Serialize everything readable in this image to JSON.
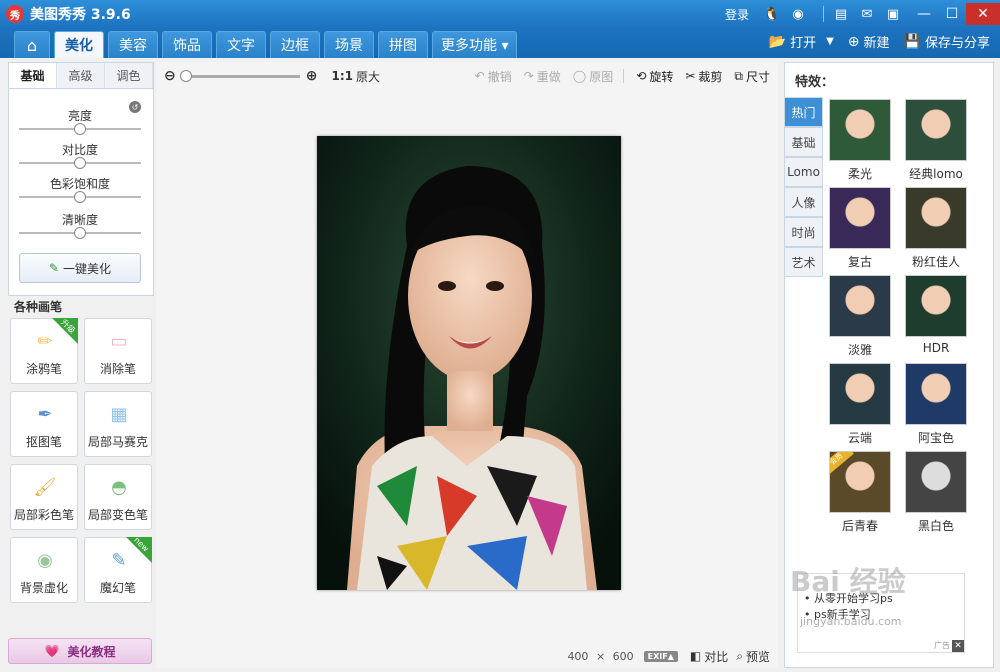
{
  "app": {
    "logo_text": "秀",
    "title": "美图秀秀 3.9.6",
    "login": "登录"
  },
  "tabs": [
    {
      "label": "⌂",
      "kind": "home"
    },
    {
      "label": "美化",
      "kind": "active"
    },
    {
      "label": "美容"
    },
    {
      "label": "饰品"
    },
    {
      "label": "文字"
    },
    {
      "label": "边框"
    },
    {
      "label": "场景"
    },
    {
      "label": "拼图"
    },
    {
      "label": "更多功能 ▾",
      "kind": "more"
    }
  ],
  "menu_right": {
    "open": "打开",
    "new": "新建",
    "save": "保存与分享"
  },
  "left": {
    "subtabs": [
      "基础",
      "高级",
      "调色"
    ],
    "sliders": [
      {
        "label": "亮度",
        "value": 0.5
      },
      {
        "label": "对比度",
        "value": 0.5
      },
      {
        "label": "色彩饱和度",
        "value": 0.5
      },
      {
        "label": "清晰度",
        "value": 0.5
      }
    ],
    "onekey": "一键美化",
    "brush_title": "各种画笔",
    "brushes": [
      {
        "label": "涂鸦笔",
        "icon": "pencil-icon",
        "ribbon": "升级"
      },
      {
        "label": "消除笔",
        "icon": "eraser-icon"
      },
      {
        "label": "抠图笔",
        "icon": "cutout-pen-icon"
      },
      {
        "label": "局部马赛克",
        "icon": "mosaic-icon"
      },
      {
        "label": "局部彩色笔",
        "icon": "color-brush-icon"
      },
      {
        "label": "局部变色笔",
        "icon": "bucket-icon"
      },
      {
        "label": "背景虚化",
        "icon": "blur-icon"
      },
      {
        "label": "魔幻笔",
        "icon": "magic-pen-icon",
        "ribbon": "new"
      }
    ],
    "tutorial": "美化教程"
  },
  "toolbar": {
    "zoom_ratio": "1:1",
    "zoom_orig": "原大",
    "undo": "撤销",
    "redo": "重做",
    "original": "原图",
    "rotate": "旋转",
    "crop": "裁剪",
    "resize": "尺寸",
    "zoom_level": 0
  },
  "status": {
    "width": "400",
    "times": "×",
    "height": "600",
    "exif": "EXIF▲",
    "compare": "对比",
    "preview": "预览"
  },
  "right": {
    "title": "特效：",
    "side_tabs": [
      "热门",
      "基础",
      "Lomo",
      "人像",
      "时尚",
      "艺术"
    ],
    "effects": [
      {
        "label": "柔光"
      },
      {
        "label": "经典lomo"
      },
      {
        "label": "复古"
      },
      {
        "label": "粉红佳人"
      },
      {
        "label": "淡雅"
      },
      {
        "label": "HDR"
      },
      {
        "label": "云端"
      },
      {
        "label": "阿宝色"
      },
      {
        "label": "后青春",
        "badge": "会员"
      },
      {
        "label": "黑白色"
      }
    ],
    "ad_lines": [
      "• 从零开始学习ps",
      "• ps新手学习"
    ],
    "ad_tag": "广告"
  },
  "watermark": {
    "main": "Bai 经验",
    "sub": "jingyan.baidu.com"
  },
  "colors": {
    "title_bar": "#1d73c0",
    "tab_active_text": "#1b5fa3",
    "side_tab_active": "#3d8fd6",
    "tutorial_text": "#8a2d83"
  }
}
